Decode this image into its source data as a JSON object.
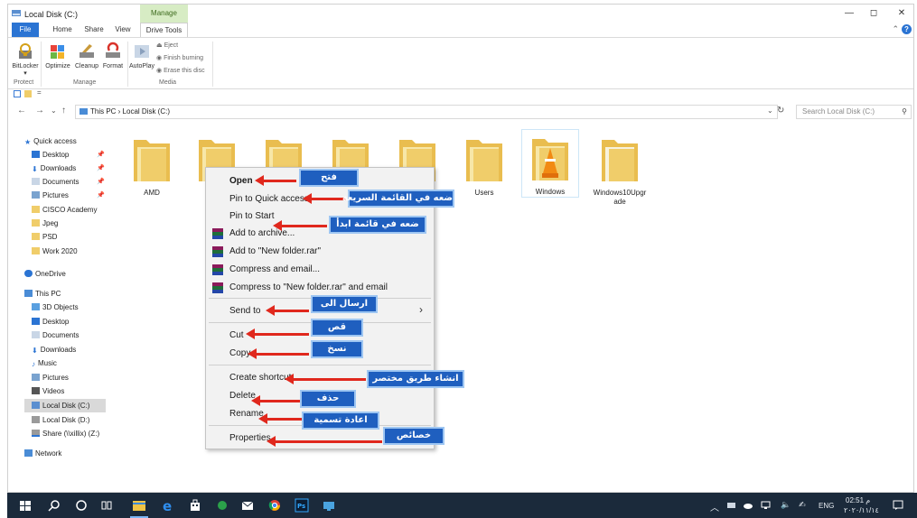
{
  "window": {
    "title": "Local Disk (C:)",
    "manage_label": "Manage",
    "controls": {
      "minimize": "—",
      "maximize": "◻",
      "close": "✕"
    }
  },
  "ribbon_tabs": [
    {
      "label": "File"
    },
    {
      "label": "Home"
    },
    {
      "label": "Share"
    },
    {
      "label": "View"
    },
    {
      "label": "Drive Tools"
    }
  ],
  "ribbon": {
    "buttons": {
      "bitlocker": "BitLocker",
      "optimize": "Optimize",
      "cleanup": "Cleanup",
      "format": "Format",
      "autoplay": "AutoPlay"
    },
    "small_commands": {
      "eject": "Eject",
      "finish_burning": "Finish burning",
      "erase_disc": "Erase this disc"
    },
    "groups": {
      "protect": "Protect",
      "manage": "Manage",
      "media": "Media"
    }
  },
  "address": {
    "path": "This PC  ›  Local Disk (C:)",
    "search_placeholder": "Search Local Disk (C:)"
  },
  "nav": {
    "quick_access": "Quick access",
    "items": [
      {
        "label": "Desktop",
        "pinned": true
      },
      {
        "label": "Downloads",
        "pinned": true
      },
      {
        "label": "Documents",
        "pinned": true
      },
      {
        "label": "Pictures",
        "pinned": true
      },
      {
        "label": "CISCO Academy",
        "pinned": false
      },
      {
        "label": "Jpeg",
        "pinned": false
      },
      {
        "label": "PSD",
        "pinned": false
      },
      {
        "label": "Work 2020",
        "pinned": false
      }
    ],
    "onedrive": "OneDrive",
    "this_pc": "This PC",
    "pc_items": [
      {
        "label": "3D Objects"
      },
      {
        "label": "Desktop"
      },
      {
        "label": "Documents"
      },
      {
        "label": "Downloads"
      },
      {
        "label": "Music"
      },
      {
        "label": "Pictures"
      },
      {
        "label": "Videos"
      },
      {
        "label": "Local Disk (C:)",
        "selected": true
      },
      {
        "label": "Local Disk (D:)"
      },
      {
        "label": "Share (\\\\xillix) (Z:)"
      }
    ],
    "network": "Network"
  },
  "folders": [
    {
      "label": "AMD"
    },
    {
      "label": ""
    },
    {
      "label": ""
    },
    {
      "label": ""
    },
    {
      "label": ""
    },
    {
      "label": "Users"
    },
    {
      "label": "Windows",
      "vlc": true
    },
    {
      "label": "Windows10Upgr ade"
    }
  ],
  "context_menu": {
    "open": "Open",
    "pin_quick_access": "Pin to Quick access",
    "pin_start": "Pin to Start",
    "add_archive": "Add to archive...",
    "add_rar": "Add to \"New folder.rar\"",
    "compress_email": "Compress and email...",
    "compress_rar_email": "Compress to \"New folder.rar\" and email",
    "send_to": "Send to",
    "cut": "Cut",
    "copy": "Copy",
    "create_shortcut": "Create shortcut",
    "delete": "Delete",
    "rename": "Rename",
    "properties": "Properties"
  },
  "annotations": {
    "open": "فتح",
    "pin_quick_access": "ضعه في القائمة السريعة",
    "pin_start": "ضعه في قائمة ابدأ",
    "send_to": "ارسال الى",
    "cut": "قص",
    "copy": "نسخ",
    "create_shortcut": "انشاء طريق مختصر",
    "delete": "حذف",
    "rename": "اعادة تسمية",
    "properties": "خصائص"
  },
  "taskbar": {
    "lang": "ENG",
    "time": "02:51 م",
    "date": "٢٠٢٠/١١/١٤"
  },
  "colors": {
    "accent": "#2b74d3",
    "callout": "#1f5fbf",
    "arrow": "#e0281d",
    "taskbar": "#1b2a3b",
    "folder": "#f0cd6a"
  }
}
